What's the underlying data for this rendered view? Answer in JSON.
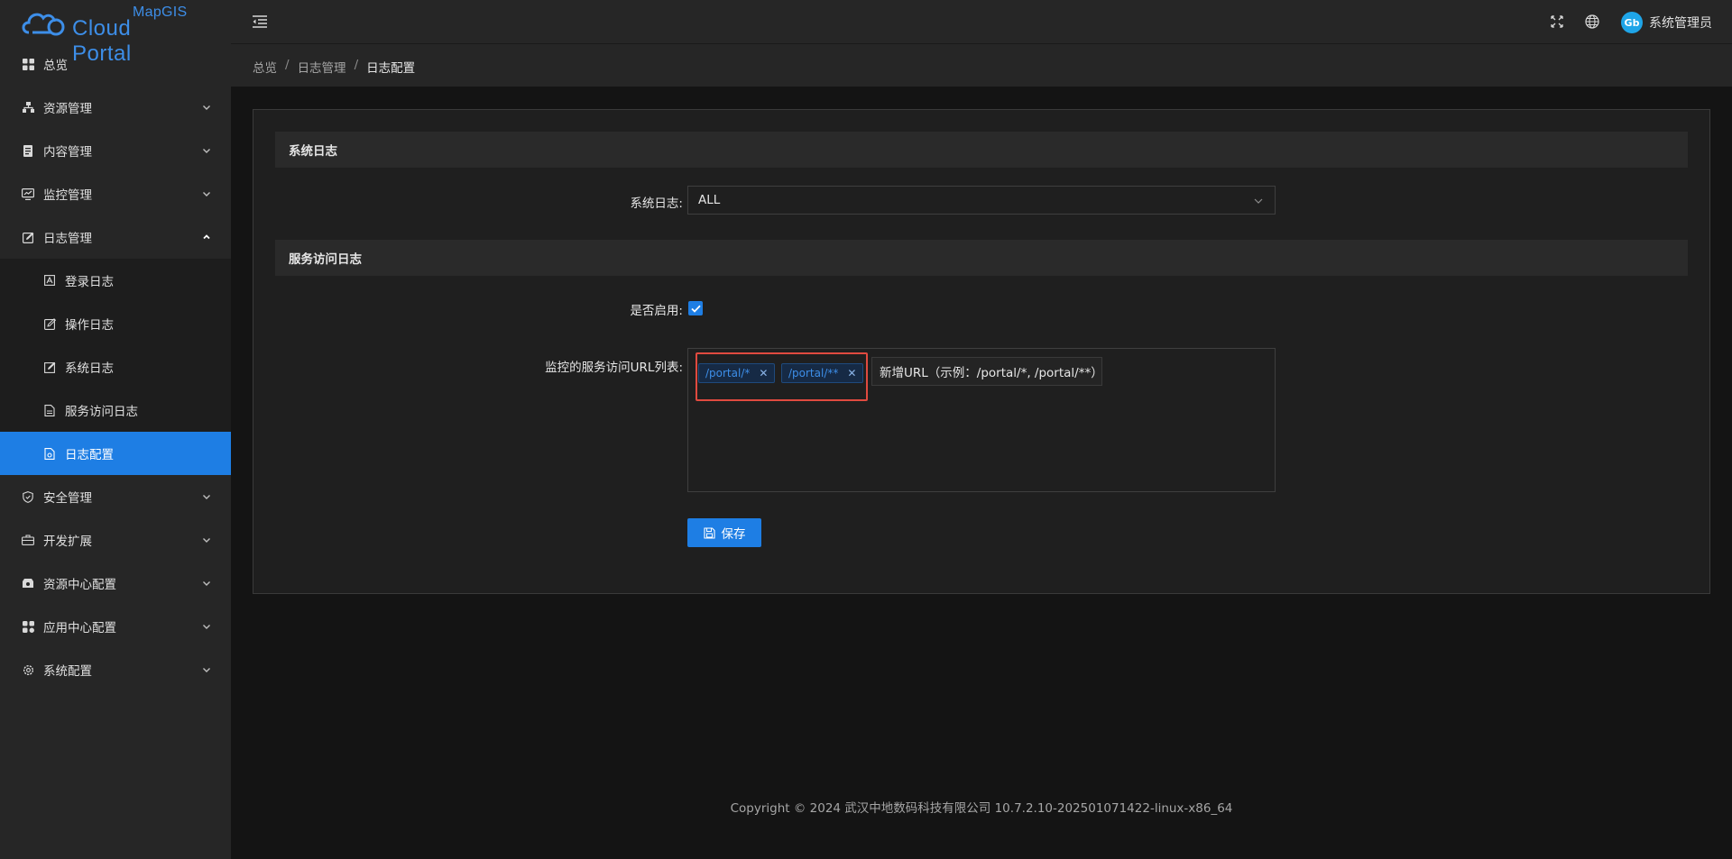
{
  "logo": {
    "top": "MapGIS",
    "brand": "Cloud Portal"
  },
  "sidebar": {
    "items": [
      {
        "label": "总览",
        "icon": "dashboard-icon"
      },
      {
        "label": "资源管理",
        "icon": "resource-icon"
      },
      {
        "label": "内容管理",
        "icon": "content-icon"
      },
      {
        "label": "监控管理",
        "icon": "monitor-icon"
      },
      {
        "label": "日志管理",
        "icon": "log-icon"
      },
      {
        "label": "安全管理",
        "icon": "shield-icon"
      },
      {
        "label": "开发扩展",
        "icon": "briefcase-icon"
      },
      {
        "label": "资源中心配置",
        "icon": "resource-center-icon"
      },
      {
        "label": "应用中心配置",
        "icon": "apps-icon"
      },
      {
        "label": "系统配置",
        "icon": "gear-icon"
      }
    ],
    "log_submenu": [
      {
        "label": "登录日志",
        "icon": "login-log-icon"
      },
      {
        "label": "操作日志",
        "icon": "edit-log-icon"
      },
      {
        "label": "系统日志",
        "icon": "system-log-icon"
      },
      {
        "label": "服务访问日志",
        "icon": "file-icon"
      },
      {
        "label": "日志配置",
        "icon": "log-config-icon"
      }
    ]
  },
  "header": {
    "username": "系统管理员",
    "avatar_text": "Gb"
  },
  "breadcrumb": {
    "items": [
      "总览",
      "日志管理",
      "日志配置"
    ],
    "separator": "/"
  },
  "form": {
    "section1_title": "系统日志",
    "syslog_label": "系统日志:",
    "syslog_value": "ALL",
    "section2_title": "服务访问日志",
    "enabled_label": "是否启用:",
    "enabled": true,
    "url_list_label": "监控的服务访问URL列表:",
    "tags": [
      "/portal/*",
      "/portal/**"
    ],
    "url_input_value": "新增URL（示例：/portal/*, /portal/**）",
    "save_label": "保存"
  },
  "footer": {
    "text": "Copyright © 2024 武汉中地数码科技有限公司 10.7.2.10-202501071422-linux-x86_64"
  },
  "colors": {
    "accent": "#1e7ee4",
    "highlight": "#e04a3f",
    "background": "#141414",
    "panel": "#262626"
  }
}
